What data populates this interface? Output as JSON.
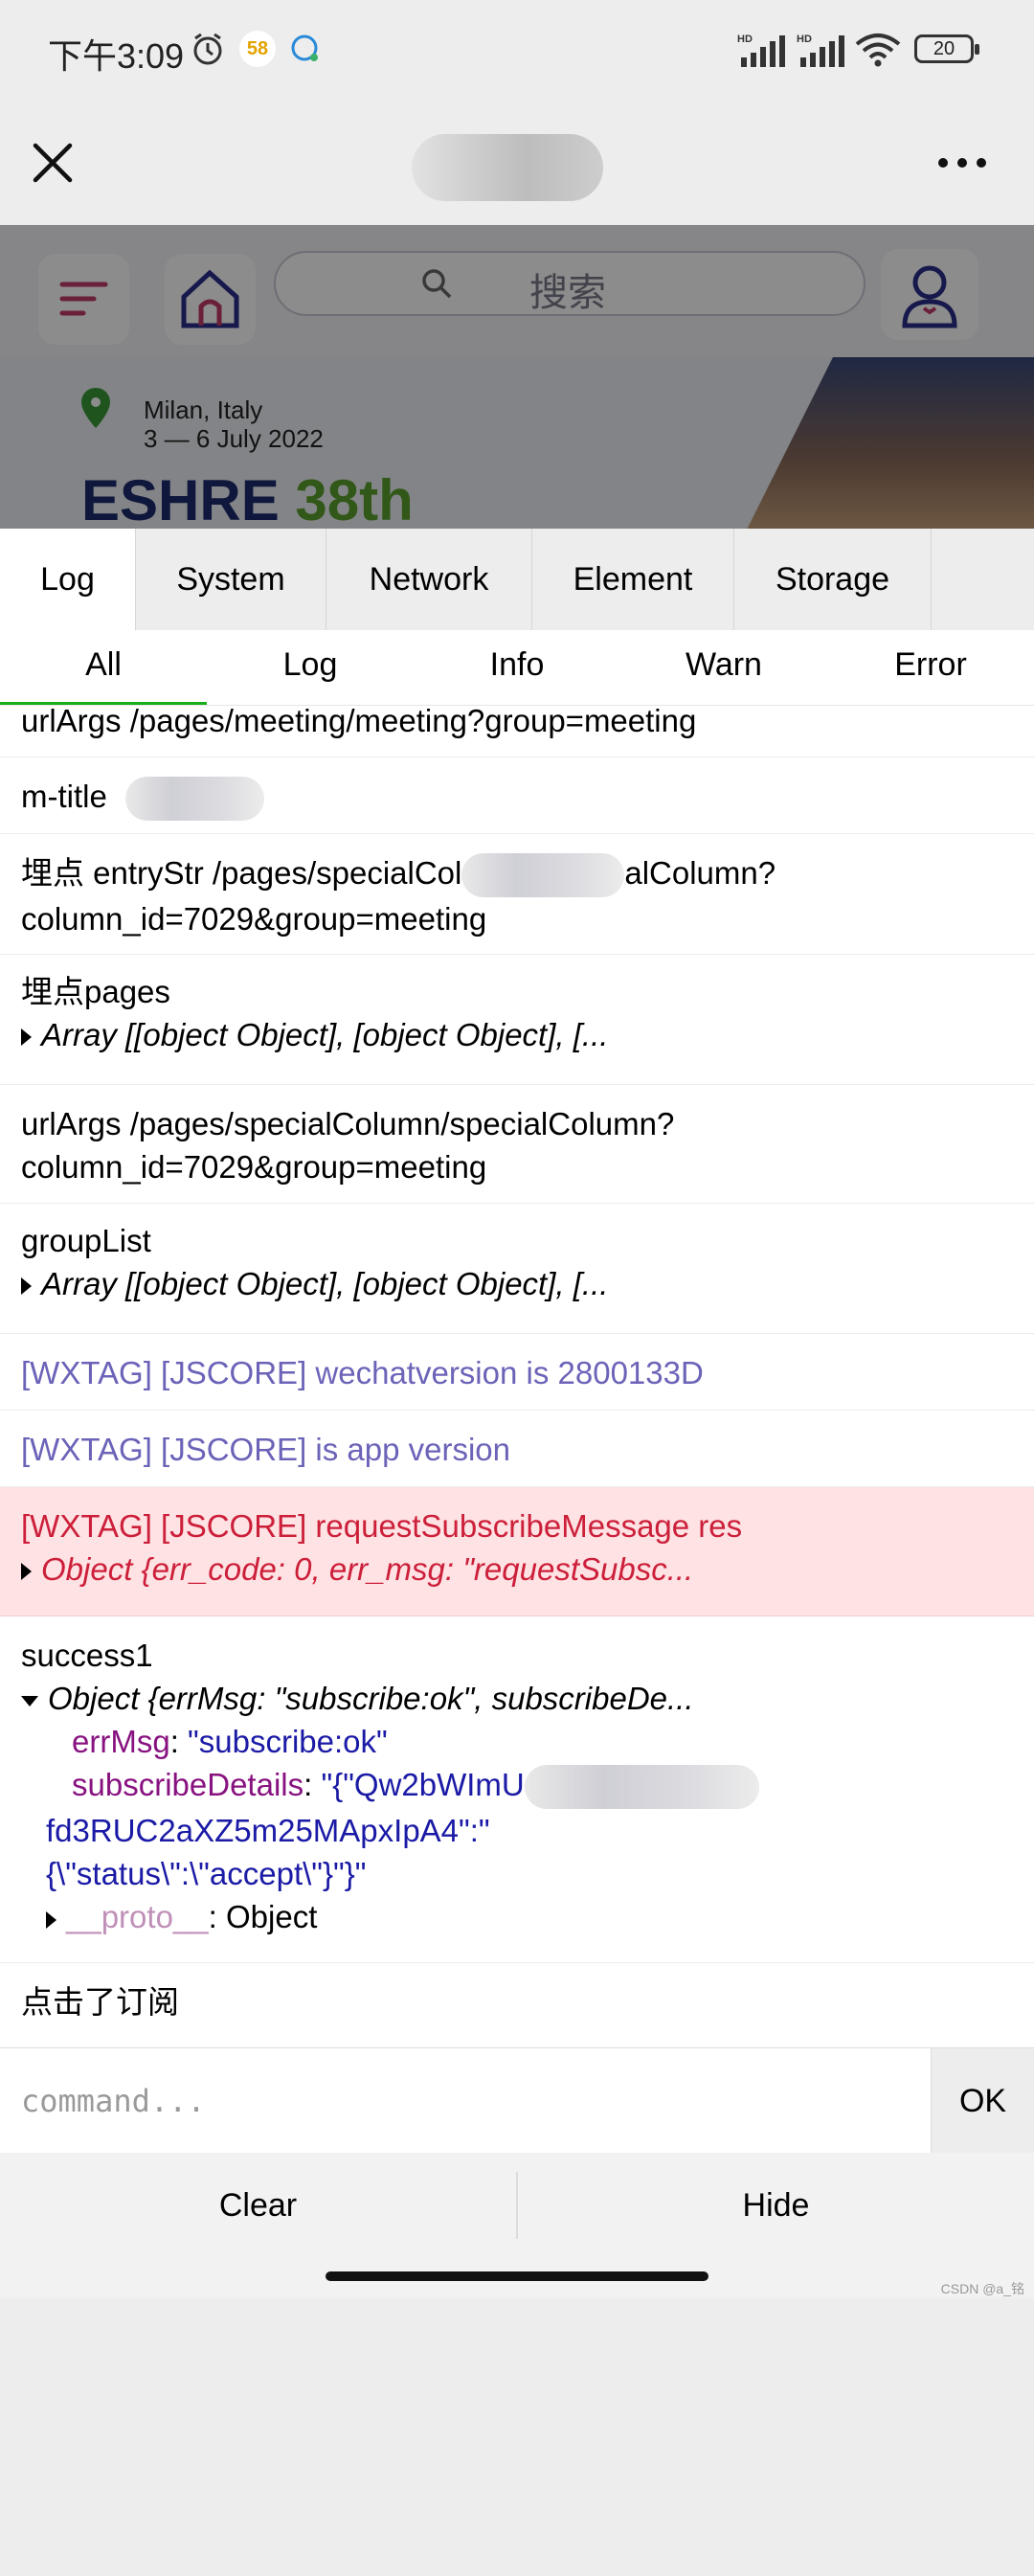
{
  "status_bar": {
    "time": "下午3:09",
    "app_badge_58": "58",
    "battery": "20",
    "network_labels": [
      "HD",
      "HD"
    ]
  },
  "webpage": {
    "search_placeholder": "搜索",
    "banner_location": "Milan, Italy",
    "banner_dates": "3 — 6 July 2022",
    "banner_title_main": "ESHRE",
    "banner_title_year": "38th"
  },
  "console": {
    "tabs": [
      "Log",
      "System",
      "Network",
      "Element",
      "Storage"
    ],
    "active_tab": "Log",
    "subtabs": [
      "All",
      "Log",
      "Info",
      "Warn",
      "Error"
    ],
    "active_subtab": "All",
    "logs": {
      "l0": "urlArgs /pages/meeting/meeting?group=meeting",
      "l1": "m-title",
      "l2a": "埋点 entryStr /pages/specialCol",
      "l2b": "alColumn?",
      "l2c": "column_id=7029&group=meeting",
      "l3a": "埋点pages",
      "l3b": "Array [[object Object], [object Object], [...",
      "l4a": "urlArgs /pages/specialColumn/specialColumn?",
      "l4b": "column_id=7029&group=meeting",
      "l5a": "groupList",
      "l5b": "Array [[object Object], [object Object], [...",
      "l6": "[WXTAG] [JSCORE] wechatversion is 2800133D",
      "l7": "[WXTAG] [JSCORE] is app version",
      "l8a": "[WXTAG] [JSCORE] requestSubscribeMessage res",
      "l8b": "Object {err_code: 0, err_msg: \"requestSubsc...",
      "l9a": "success1",
      "l9b": "Object {errMsg: \"subscribe:ok\", subscribeDe...",
      "l9_errmsg_key": "errMsg",
      "l9_errmsg_val": "\"subscribe:ok\"",
      "l9_details_key": "subscribeDetails",
      "l9_details_val1": "\"{\"Qw2bWImU",
      "l9_details_val2": "fd3RUC2aXZ5m25MApxIpA4\":\"",
      "l9_details_val3": "{\\\"status\\\":\\\"accept\\\"}\"}\"",
      "l9_proto_key": "__proto__",
      "l9_proto_val": "Object",
      "l10": "点击了订阅"
    },
    "command_placeholder": "command...",
    "ok_label": "OK",
    "clear_label": "Clear",
    "hide_label": "Hide"
  },
  "watermark": "CSDN @a_铭",
  "colors": {
    "info_text": "#6b63b8",
    "error_text": "#cc1f3a",
    "error_bg": "#ffe2e3",
    "accent": "#1aad19"
  }
}
